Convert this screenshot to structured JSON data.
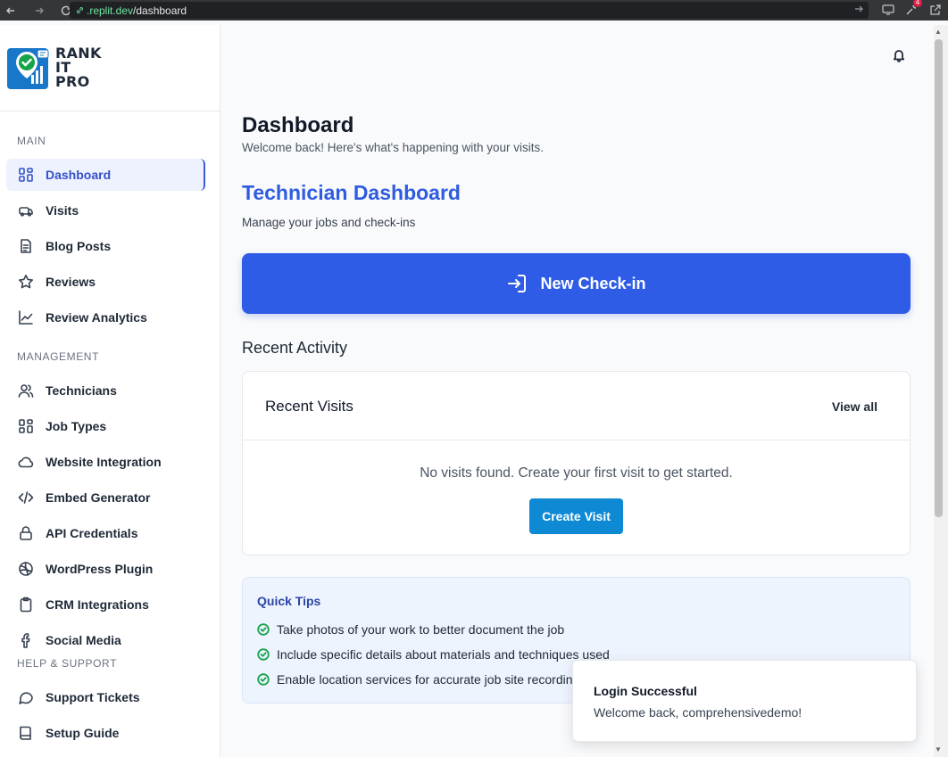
{
  "browser": {
    "url_domain": ".replit.dev",
    "url_path": "/dashboard",
    "badge_count": "4"
  },
  "logo": {
    "line1": "RANK",
    "line2": "IT",
    "line3": "PRO"
  },
  "sidebar": {
    "sections": {
      "main": "MAIN",
      "management": "MANAGEMENT",
      "help": "HELP & SUPPORT"
    },
    "items": [
      {
        "label": "Dashboard",
        "icon": "grid-icon"
      },
      {
        "label": "Visits",
        "icon": "truck-icon"
      },
      {
        "label": "Blog Posts",
        "icon": "document-icon"
      },
      {
        "label": "Reviews",
        "icon": "star-icon"
      },
      {
        "label": "Review Analytics",
        "icon": "chart-line-icon"
      },
      {
        "label": "Technicians",
        "icon": "users-icon"
      },
      {
        "label": "Job Types",
        "icon": "grid-icon"
      },
      {
        "label": "Website Integration",
        "icon": "cloud-icon"
      },
      {
        "label": "Embed Generator",
        "icon": "code-icon"
      },
      {
        "label": "API Credentials",
        "icon": "lock-icon"
      },
      {
        "label": "WordPress Plugin",
        "icon": "wordpress-icon"
      },
      {
        "label": "CRM Integrations",
        "icon": "clipboard-icon"
      },
      {
        "label": "Social Media",
        "icon": "facebook-icon"
      },
      {
        "label": "Support Tickets",
        "icon": "chat-icon"
      },
      {
        "label": "Setup Guide",
        "icon": "book-icon"
      }
    ]
  },
  "main": {
    "title": "Dashboard",
    "subtitle": "Welcome back! Here's what's happening with your visits.",
    "tech_title": "Technician Dashboard",
    "tech_subtitle": "Manage your jobs and check-ins",
    "checkin_label": "New Check-in",
    "recent_activity": "Recent Activity",
    "visits_card": {
      "title": "Recent Visits",
      "view_all": "View all",
      "empty": "No visits found. Create your first visit to get started.",
      "create_label": "Create Visit"
    },
    "tips": {
      "title": "Quick Tips",
      "items": [
        "Take photos of your work to better document the job",
        "Include specific details about materials and techniques used",
        "Enable location services for accurate job site recording"
      ]
    }
  },
  "toast": {
    "title": "Login Successful",
    "message": "Welcome back, comprehensivedemo!"
  }
}
